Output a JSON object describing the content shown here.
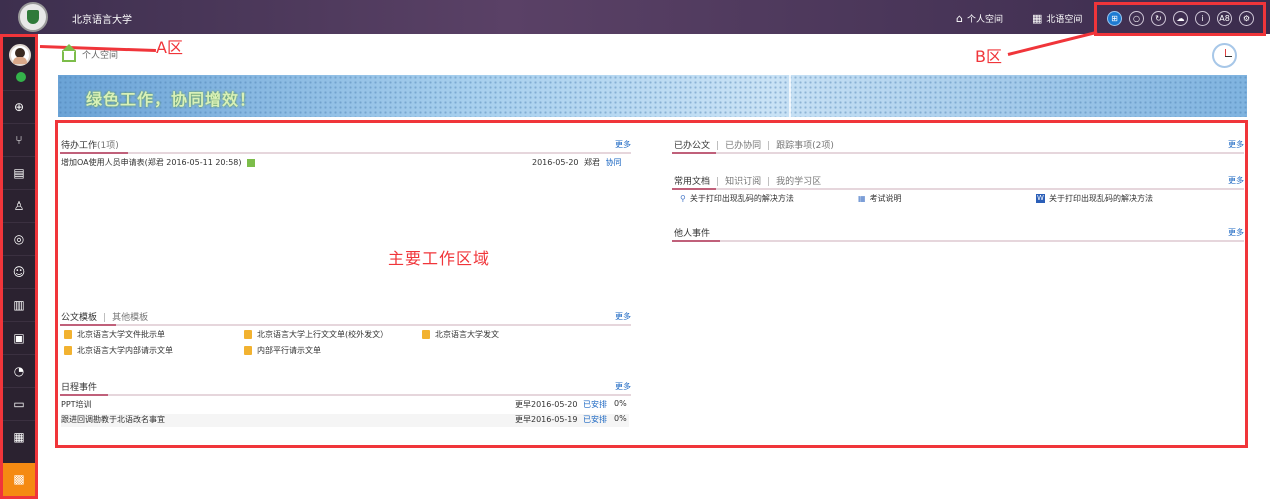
{
  "header": {
    "school_name": "北京语言大学",
    "nav_personal": "个人空间",
    "nav_space": "北语空间",
    "icons": [
      "windows-icon",
      "search-icon",
      "refresh-icon",
      "cloud-icon",
      "info-icon",
      "a8-icon",
      "settings-icon"
    ],
    "icon_a8_text": "A8"
  },
  "annotations": {
    "zone_a": "A区",
    "zone_b": "B区",
    "main_area": "主要工作区域"
  },
  "breadcrumb": {
    "label": "个人空间"
  },
  "banner": {
    "text": "绿色工作，协同增效！"
  },
  "todo": {
    "title": "待办工作",
    "count": "(1项)",
    "more": "更多",
    "item_text": "增加OA使用人员申请表(郑君 2016-05-11 20:58)",
    "item_date": "2016-05-20",
    "item_person": "郑君",
    "item_type": "协同"
  },
  "templates": {
    "tab_official": "公文模板",
    "tab_other": "其他模板",
    "more": "更多",
    "items": [
      "北京语言大学文件批示单",
      "北京语言大学上行文文单(校外发文）",
      "北京语言大学发文",
      "北京语言大学内部请示文单",
      "内部平行请示文单"
    ]
  },
  "schedule": {
    "title": "日程事件",
    "more": "更多",
    "rows": [
      {
        "name": "PPT培训",
        "date": "更早2016-05-20",
        "status": "已安排",
        "pct": "0%"
      },
      {
        "name": "跟进回调勘教于北语改名事宜",
        "date": "更早2016-05-19",
        "status": "已安排",
        "pct": "0%"
      }
    ]
  },
  "done": {
    "tab1": "已办公文",
    "tab2": "已办协同",
    "tab3": "跟踪事项",
    "tab3_count": "(2项)",
    "more": "更多"
  },
  "docs": {
    "tab1": "常用文档",
    "tab2": "知识订阅",
    "tab3": "我的学习区",
    "more": "更多",
    "items": [
      "关于打印出现乱码的解决方法",
      "考试说明",
      "关于打印出现乱码的解决方法"
    ]
  },
  "others": {
    "title": "他人事件",
    "more": "更多"
  },
  "colors": {
    "accent_red": "#f0353a",
    "header_purple": "#4a3858",
    "link_blue": "#1a66c2",
    "sidebar_active": "#f58a12"
  }
}
